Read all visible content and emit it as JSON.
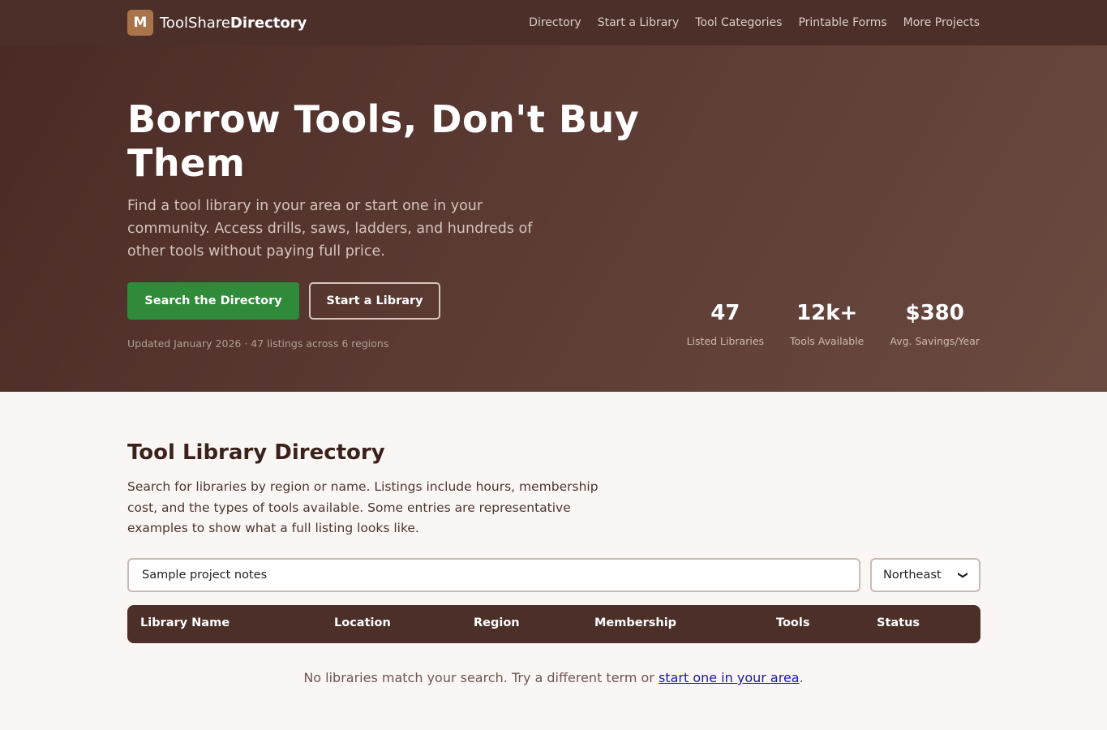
{
  "brand": {
    "logo_letter": "M",
    "name_light": "ToolShare",
    "name_bold": "Directory"
  },
  "nav": [
    "Directory",
    "Start a Library",
    "Tool Categories",
    "Printable Forms",
    "More Projects"
  ],
  "hero": {
    "title": "Borrow Tools, Don't Buy Them",
    "lede": "Find a tool library in your area or start one in your community. Access drills, saws, ladders, and hundreds of other tools without paying full price.",
    "primary_button": "Search the Directory",
    "secondary_button": "Start a Library",
    "updated": "Updated January 2026 · 47 listings across 6 regions",
    "stats": [
      {
        "value": "47",
        "label": "Listed Libraries"
      },
      {
        "value": "12k+",
        "label": "Tools Available"
      },
      {
        "value": "$380",
        "label": "Avg. Savings/Year"
      }
    ]
  },
  "directory": {
    "title": "Tool Library Directory",
    "description": "Search for libraries by region or name. Listings include hours, membership cost, and the types of tools available. Some entries are representative examples to show what a full listing looks like.",
    "search_value": "Sample project notes",
    "region_selected": "Northeast",
    "columns": [
      "Library Name",
      "Location",
      "Region",
      "Membership",
      "Tools",
      "Status"
    ],
    "empty_text": "No libraries match your search. Try a different term or ",
    "empty_link": "start one in your area",
    "empty_suffix": "."
  },
  "colors": {
    "brand_brown": "#4c2f29",
    "primary_green": "#2f8a39",
    "logo_accent": "#a9744a"
  }
}
